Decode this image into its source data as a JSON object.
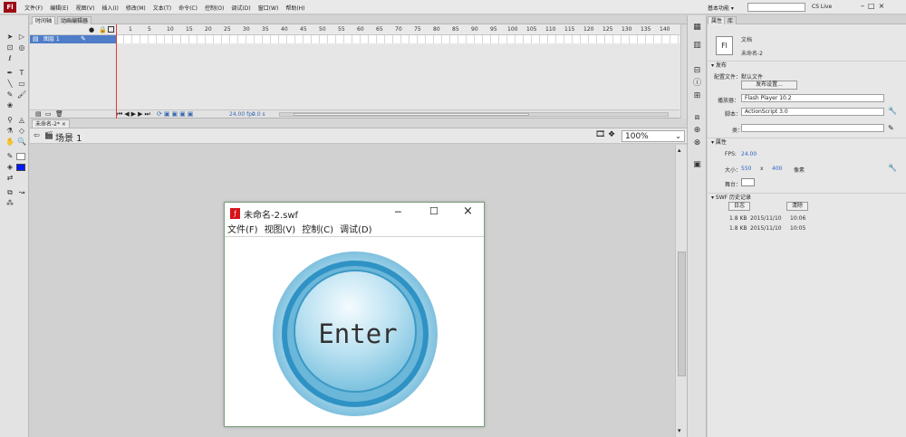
{
  "app": {
    "logo": "Fl"
  },
  "menu": [
    "文件(F)",
    "编辑(E)",
    "视图(V)",
    "插入(I)",
    "修改(M)",
    "文本(T)",
    "命令(C)",
    "控制(O)",
    "调试(D)",
    "窗口(W)",
    "帮助(H)"
  ],
  "workspace": {
    "name": "基本功能 ▾",
    "cs_live": "CS Live"
  },
  "window_controls": {
    "minimize": "–",
    "maximize": "□",
    "close": "×"
  },
  "timeline": {
    "tabs": [
      "时间轴",
      "动画编辑器"
    ],
    "ruler": [
      "1",
      "5",
      "10",
      "15",
      "20",
      "25",
      "30",
      "35",
      "40",
      "45",
      "50",
      "55",
      "60",
      "65",
      "70",
      "75",
      "80",
      "85",
      "90",
      "95",
      "100",
      "105",
      "110",
      "115",
      "120",
      "125",
      "130",
      "135",
      "140",
      "145"
    ],
    "layer_name": "图层 1",
    "fps": "24.00 fps",
    "time": "0.0 s"
  },
  "document": {
    "tab": "未命名-2*",
    "scene": "场景 1",
    "zoom": "100%"
  },
  "properties": {
    "tabs": [
      "属性",
      "库"
    ],
    "doc_type": "文档",
    "doc_name": "未命名-2",
    "section_publish": "发布",
    "profile_label": "配置文件：",
    "profile_value": "默认文件",
    "publish_settings_btn": "发布设置...",
    "player_label": "播放器：",
    "player_value": "Flash Player 10.2",
    "script_label": "脚本：",
    "script_value": "ActionScript 3.0",
    "class_label": "类：",
    "section_props": "属性",
    "fps_label": "FPS:",
    "fps_value": "24.00",
    "size_label": "大小：",
    "width": "550",
    "x": "x",
    "height": "400",
    "unit": "像素",
    "stage_label": "舞台：",
    "section_history": "SWF 历史记录",
    "log_btn": "日志",
    "clear_btn": "清除",
    "history": [
      {
        "size": "1.8 KB",
        "date": "2015/11/10",
        "time": "10:06"
      },
      {
        "size": "1.8 KB",
        "date": "2015/11/10",
        "time": "10:05"
      }
    ]
  },
  "swf_window": {
    "title": "未命名-2.swf",
    "menu": [
      "文件(F)",
      "视图(V)",
      "控制(C)",
      "调试(D)"
    ],
    "button_text": "Enter",
    "colors": {
      "outer": "#8ecae6",
      "ring": "#3b9cc9",
      "inner": "#bfe3f1"
    }
  }
}
